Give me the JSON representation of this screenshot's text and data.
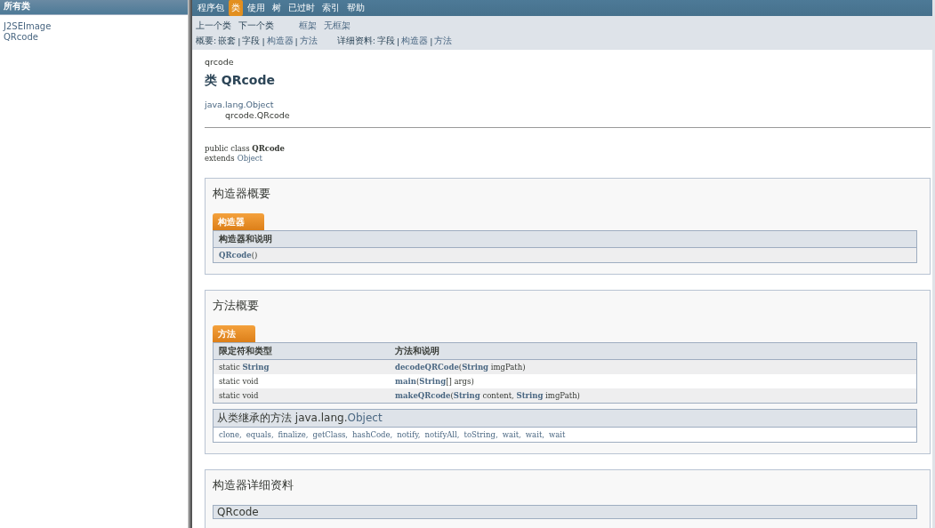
{
  "sidebar": {
    "title": "所有类",
    "classes": [
      {
        "label": "J2SEImage"
      },
      {
        "label": "QRcode"
      }
    ]
  },
  "nav": [
    {
      "label": "程序包",
      "selected": false
    },
    {
      "label": "类",
      "selected": true
    },
    {
      "label": "使用",
      "selected": false
    },
    {
      "label": "树",
      "selected": false
    },
    {
      "label": "已过时",
      "selected": false
    },
    {
      "label": "索引",
      "selected": false
    },
    {
      "label": "帮助",
      "selected": false
    }
  ],
  "subnav": {
    "prev": "上一个类",
    "next": "下一个类",
    "frames": "框架",
    "noframes": "无框架",
    "summary": {
      "label": "概要:",
      "parts": [
        {
          "text": "嵌套",
          "link": false
        },
        {
          "text": "|",
          "link": false
        },
        {
          "text": "字段",
          "link": false
        },
        {
          "text": "|",
          "link": false
        },
        {
          "text": "构造器",
          "link": true
        },
        {
          "text": "|",
          "link": false
        },
        {
          "text": "方法",
          "link": true
        }
      ]
    },
    "detail": {
      "label": "详细资料:",
      "parts": [
        {
          "text": "字段",
          "link": false
        },
        {
          "text": "|",
          "link": false
        },
        {
          "text": "构造器",
          "link": true
        },
        {
          "text": "|",
          "link": false
        },
        {
          "text": "方法",
          "link": true
        }
      ]
    }
  },
  "header": {
    "package": "qrcode",
    "title": "类 QRcode",
    "superclass": "java.lang.Object",
    "class": "qrcode.QRcode"
  },
  "signature": {
    "line": "public class **QRcode**",
    "extends": "extends",
    "superclass": "Object"
  },
  "constructor_summary": {
    "heading": "构造器概要",
    "tab": "构造器",
    "column": "构造器和说明",
    "rows": [
      {
        "name": "QRcode",
        "params": "()"
      }
    ]
  },
  "method_summary": {
    "heading": "方法概要",
    "tab": "方法",
    "columns": [
      "限定符和类型",
      "方法和说明"
    ],
    "rows": [
      {
        "modifier": [
          {
            "text": "static ",
            "link": false
          },
          {
            "text": "String",
            "link": true
          }
        ],
        "name": "decodeQRCode",
        "params": [
          {
            "text": "(",
            "link": false
          },
          {
            "text": "String",
            "link": true
          },
          {
            "text": " imgPath)",
            "link": false
          }
        ]
      },
      {
        "modifier": [
          {
            "text": "static void",
            "link": false
          }
        ],
        "name": "main",
        "params": [
          {
            "text": "(",
            "link": false
          },
          {
            "text": "String",
            "link": true
          },
          {
            "text": "[] args)",
            "link": false
          }
        ]
      },
      {
        "modifier": [
          {
            "text": "static void",
            "link": false
          }
        ],
        "name": "makeQRcode",
        "params": [
          {
            "text": "(",
            "link": false
          },
          {
            "text": "String",
            "link": true
          },
          {
            "text": " content, ",
            "link": false
          },
          {
            "text": "String",
            "link": true
          },
          {
            "text": " imgPath)",
            "link": false
          }
        ]
      }
    ],
    "inherited": {
      "heading": "从类继承的方法 java.lang.",
      "class": "Object",
      "methods": [
        "clone,",
        "equals,",
        "finalize,",
        "getClass,",
        "hashCode,",
        "notify,",
        "notifyAll,",
        "toString,",
        "wait,",
        "wait,",
        "wait"
      ]
    }
  },
  "constructor_detail": {
    "heading": "构造器详细资料",
    "name": "QRcode"
  }
}
